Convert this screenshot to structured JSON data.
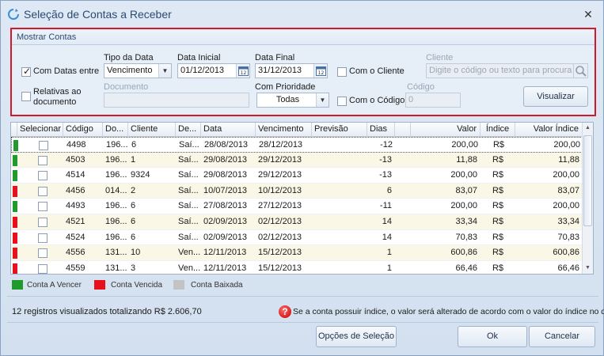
{
  "window": {
    "title": "Seleção de Contas a Receber",
    "close_glyph": "✕"
  },
  "filters": {
    "section_title": "Mostrar Contas",
    "com_datas_entre": {
      "label": "Com Datas entre",
      "checked": true
    },
    "relativas": {
      "label_line1": "Relativas ao",
      "label_line2": "documento",
      "checked": false
    },
    "tipo_data": {
      "label": "Tipo da Data",
      "value": "Vencimento"
    },
    "data_inicial": {
      "label": "Data Inicial",
      "value": "01/12/2013"
    },
    "data_final": {
      "label": "Data Final",
      "value": "31/12/2013"
    },
    "calendar_day": "12",
    "com_cliente": {
      "label": "Com o Cliente",
      "checked": false
    },
    "cliente": {
      "label": "Cliente",
      "placeholder": "Digite o código ou texto para procura"
    },
    "documento": {
      "label": "Documento",
      "value": ""
    },
    "com_prioridade": {
      "label": "Com Prioridade",
      "value": "Todas"
    },
    "com_codigo": {
      "label": "Com o Código",
      "checked": false
    },
    "codigo": {
      "label": "Código",
      "value": "0"
    },
    "visualizar_label": "Visualizar"
  },
  "grid": {
    "columns": [
      "Selecionar",
      "Código",
      "Do...",
      "Cliente",
      "De...",
      "Data",
      "Vencimento",
      "Previsão",
      "Dias",
      "",
      "Valor",
      "Índice",
      "Valor Índice"
    ],
    "rows": [
      {
        "status": "vencer",
        "codigo": "4498",
        "doc": "196...",
        "cliente": "6",
        "desc": "Saí...",
        "data": "28/08/2013",
        "vencimento": "28/12/2013",
        "previsao": "",
        "dias": "-12",
        "valor": "200,00",
        "indice": "R$",
        "valor_indice": "200,00"
      },
      {
        "status": "vencer",
        "codigo": "4503",
        "doc": "196...",
        "cliente": "1",
        "desc": "Saí...",
        "data": "29/08/2013",
        "vencimento": "29/12/2013",
        "previsao": "",
        "dias": "-13",
        "valor": "11,88",
        "indice": "R$",
        "valor_indice": "11,88"
      },
      {
        "status": "vencer",
        "codigo": "4514",
        "doc": "196...",
        "cliente": "9324",
        "desc": "Saí...",
        "data": "29/08/2013",
        "vencimento": "29/12/2013",
        "previsao": "",
        "dias": "-13",
        "valor": "200,00",
        "indice": "R$",
        "valor_indice": "200,00"
      },
      {
        "status": "vencida",
        "codigo": "4456",
        "doc": "014...",
        "cliente": "2",
        "desc": "Saí...",
        "data": "10/07/2013",
        "vencimento": "10/12/2013",
        "previsao": "",
        "dias": "6",
        "valor": "83,07",
        "indice": "R$",
        "valor_indice": "83,07"
      },
      {
        "status": "vencer",
        "codigo": "4493",
        "doc": "196...",
        "cliente": "6",
        "desc": "Saí...",
        "data": "27/08/2013",
        "vencimento": "27/12/2013",
        "previsao": "",
        "dias": "-11",
        "valor": "200,00",
        "indice": "R$",
        "valor_indice": "200,00"
      },
      {
        "status": "vencida",
        "codigo": "4521",
        "doc": "196...",
        "cliente": "6",
        "desc": "Saí...",
        "data": "02/09/2013",
        "vencimento": "02/12/2013",
        "previsao": "",
        "dias": "14",
        "valor": "33,34",
        "indice": "R$",
        "valor_indice": "33,34"
      },
      {
        "status": "vencida",
        "codigo": "4524",
        "doc": "196...",
        "cliente": "6",
        "desc": "Saí...",
        "data": "02/09/2013",
        "vencimento": "02/12/2013",
        "previsao": "",
        "dias": "14",
        "valor": "70,83",
        "indice": "R$",
        "valor_indice": "70,83"
      },
      {
        "status": "vencida",
        "codigo": "4556",
        "doc": "131...",
        "cliente": "10",
        "desc": "Ven...",
        "data": "12/11/2013",
        "vencimento": "15/12/2013",
        "previsao": "",
        "dias": "1",
        "valor": "600,86",
        "indice": "R$",
        "valor_indice": "600,86"
      },
      {
        "status": "vencida",
        "codigo": "4559",
        "doc": "131...",
        "cliente": "3",
        "desc": "Ven...",
        "data": "12/11/2013",
        "vencimento": "15/12/2013",
        "previsao": "",
        "dias": "1",
        "valor": "66,46",
        "indice": "R$",
        "valor_indice": "66,46"
      }
    ]
  },
  "legend": [
    {
      "label": "Conta A Vencer",
      "color": "#1f9a2c"
    },
    {
      "label": "Conta Vencida",
      "color": "#e8101a"
    },
    {
      "label": "Conta Baixada",
      "color": "#c3c3c3"
    }
  ],
  "status_colors": {
    "vencer": "#1f9a2c",
    "vencida": "#e8101a",
    "baixada": "#c3c3c3"
  },
  "footer": {
    "summary": "12 registros visualizados totalizando R$ 2.606,70",
    "notice": "Se a conta possuir índice, o valor será alterado de acordo com o valor do índice no dia",
    "notice_icon_glyph": "?"
  },
  "buttons": {
    "opcoes": "Opções de Seleção",
    "ok": "Ok",
    "cancelar": "Cancelar"
  }
}
